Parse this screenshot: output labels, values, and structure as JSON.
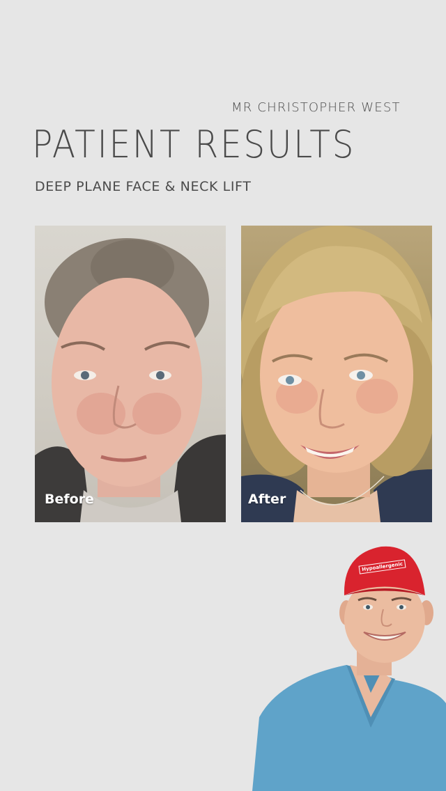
{
  "brand": "MR CHRISTOPHER WEST",
  "title": "PATIENT RESULTS",
  "subtitle": "DEEP PLANE FACE & NECK LIFT",
  "photos": {
    "before_label": "Before",
    "after_label": "After"
  },
  "surgeon": {
    "cap_text": "Hypoallergenic"
  },
  "colors": {
    "background": "#e6e6e6",
    "text": "#4a4a4a",
    "cap_red": "#d9232e",
    "scrubs_blue": "#5fa3c9"
  }
}
